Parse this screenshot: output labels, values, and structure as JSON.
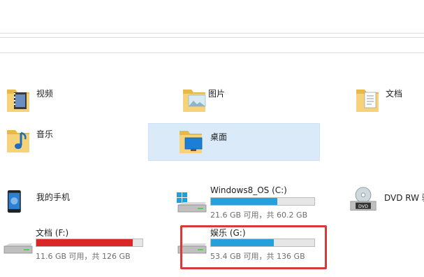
{
  "folders": [
    {
      "label": "视频",
      "icon": "video-folder-icon"
    },
    {
      "label": "图片",
      "icon": "pictures-folder-icon"
    },
    {
      "label": "文档",
      "icon": "documents-folder-icon"
    },
    {
      "label": "音乐",
      "icon": "music-folder-icon"
    },
    {
      "label": "桌面",
      "icon": "desktop-folder-icon",
      "selected": true
    }
  ],
  "devices": {
    "phone": {
      "label": "我的手机",
      "icon": "phone-icon"
    },
    "c_drive": {
      "label": "Windows8_OS (C:)",
      "free": "21.6 GB 可用，共 60.2 GB",
      "used_fraction": 0.64,
      "fill_color": "#26a0da"
    },
    "dvd": {
      "label": "DVD RW 驱",
      "icon": "dvd-drive-icon"
    },
    "f_drive": {
      "label": "文档 (F:)",
      "free": "11.6 GB 可用，共 126 GB",
      "used_fraction": 0.91,
      "fill_color": "#da2626"
    },
    "g_drive": {
      "label": "娱乐 (G:)",
      "free": "53.4 GB 可用，共 136 GB",
      "used_fraction": 0.61,
      "fill_color": "#26a0da"
    }
  },
  "colors": {
    "selection": "#dbeaf8",
    "highlight_border": "#d63a3a"
  }
}
